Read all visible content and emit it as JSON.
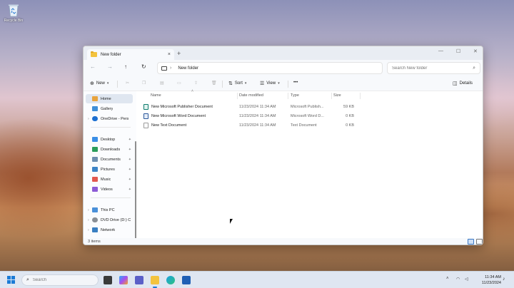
{
  "desktop": {
    "recycle_bin_label": "Recycle Bin"
  },
  "window": {
    "tab_title": "New folder",
    "tab_close": "×",
    "new_tab": "+",
    "minimize": "—",
    "maximize": "☐",
    "close": "✕",
    "address": {
      "path": "New folder"
    },
    "search": {
      "placeholder": "Search New folder"
    },
    "toolbar": {
      "new_label": "New",
      "sort_label": "Sort",
      "view_label": "View",
      "more_label": "•••",
      "details_label": "Details"
    },
    "sidebar": {
      "home": "Home",
      "gallery": "Gallery",
      "onedrive": "OneDrive - Pers",
      "desktop": "Desktop",
      "downloads": "Downloads",
      "documents": "Documents",
      "pictures": "Pictures",
      "music": "Music",
      "videos": "Videos",
      "this_pc": "This PC",
      "dvd_drive": "DVD Drive (D:) C",
      "network": "Network"
    },
    "columns": {
      "name": "Name",
      "date": "Date modified",
      "type": "Type",
      "size": "Size"
    },
    "files": [
      {
        "name": "New Microsoft Publisher Document",
        "date": "11/23/2024 11:34 AM",
        "type": "Microsoft Publish...",
        "size": "59 KB"
      },
      {
        "name": "New Microsoft Word Document",
        "date": "11/23/2024 11:34 AM",
        "type": "Microsoft Word D...",
        "size": "0 KB"
      },
      {
        "name": "New Text Document",
        "date": "11/23/2024 11:34 AM",
        "type": "Text Document",
        "size": "0 KB"
      }
    ],
    "status": {
      "item_count": "3 items"
    }
  },
  "taskbar": {
    "search_placeholder": "Search",
    "time": "11:34 AM",
    "date": "11/23/2024"
  },
  "colors": {
    "accent": "#1a7bd6",
    "folder": "#f3c33e",
    "selected_nav": "#dfe6f0"
  }
}
